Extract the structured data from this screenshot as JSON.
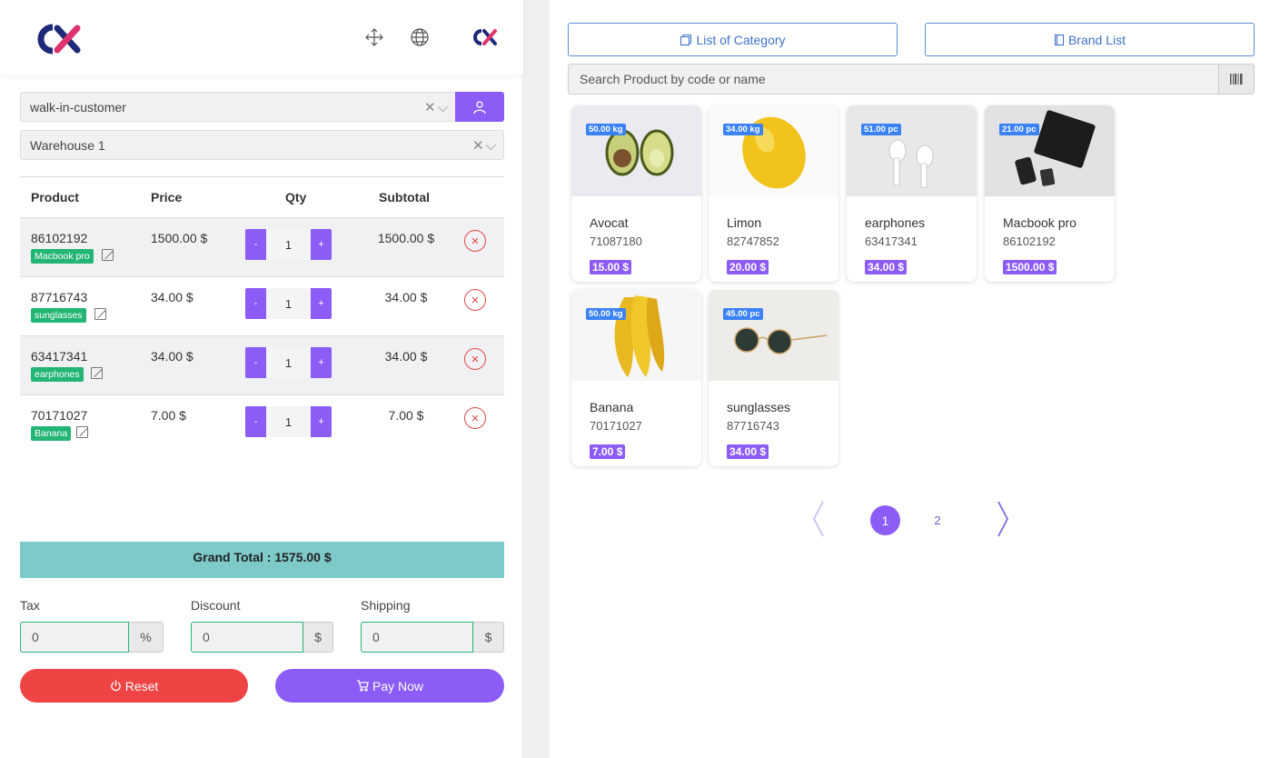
{
  "header": {
    "icons": [
      "fullscreen-icon",
      "globe-icon"
    ]
  },
  "customer": {
    "value": "walk-in-customer"
  },
  "warehouse": {
    "value": "Warehouse 1"
  },
  "table": {
    "headers": {
      "product": "Product",
      "price": "Price",
      "qty": "Qty",
      "subtotal": "Subtotal"
    },
    "rows": [
      {
        "code": "86102192",
        "name": "Macbook pro",
        "price": "1500.00 $",
        "qty": "1",
        "subtotal": "1500.00 $"
      },
      {
        "code": "87716743",
        "name": "sunglasses",
        "price": "34.00 $",
        "qty": "1",
        "subtotal": "34.00 $"
      },
      {
        "code": "63417341",
        "name": "earphones",
        "price": "34.00 $",
        "qty": "1",
        "subtotal": "34.00 $"
      },
      {
        "code": "70171027",
        "name": "Banana",
        "price": "7.00 $",
        "qty": "1",
        "subtotal": "7.00 $"
      }
    ],
    "minus": "-",
    "plus": "+"
  },
  "grand_total": "Grand Total : 1575.00 $",
  "fields": {
    "tax": {
      "label": "Tax",
      "value": "0",
      "suffix": "%"
    },
    "discount": {
      "label": "Discount",
      "value": "0",
      "suffix": "$"
    },
    "shipping": {
      "label": "Shipping",
      "value": "0",
      "suffix": "$"
    }
  },
  "actions": {
    "reset": "Reset",
    "pay": "Pay Now"
  },
  "right": {
    "category_btn": "List of Category",
    "brand_btn": "Brand List",
    "search_placeholder": "Search Product by code or name"
  },
  "products": [
    {
      "name": "Avocat",
      "code": "71087180",
      "price": "15.00 $",
      "stock": "50.00 kg"
    },
    {
      "name": "Limon",
      "code": "82747852",
      "price": "20.00 $",
      "stock": "34.00 kg"
    },
    {
      "name": "earphones",
      "code": "63417341",
      "price": "34.00 $",
      "stock": "51.00 pc"
    },
    {
      "name": "Macbook pro",
      "code": "86102192",
      "price": "1500.00 $",
      "stock": "21.00 pc"
    },
    {
      "name": "Banana",
      "code": "70171027",
      "price": "7.00 $",
      "stock": "50.00 kg"
    },
    {
      "name": "sunglasses",
      "code": "87716743",
      "price": "34.00 $",
      "stock": "45.00 pc"
    }
  ],
  "pagination": {
    "current": "1",
    "next": "2"
  },
  "colors": {
    "accent": "#8b5cf6",
    "success": "#22b573",
    "danger": "#ef4444",
    "total_bg": "#7ecac9",
    "badge": "#3b82f6"
  }
}
